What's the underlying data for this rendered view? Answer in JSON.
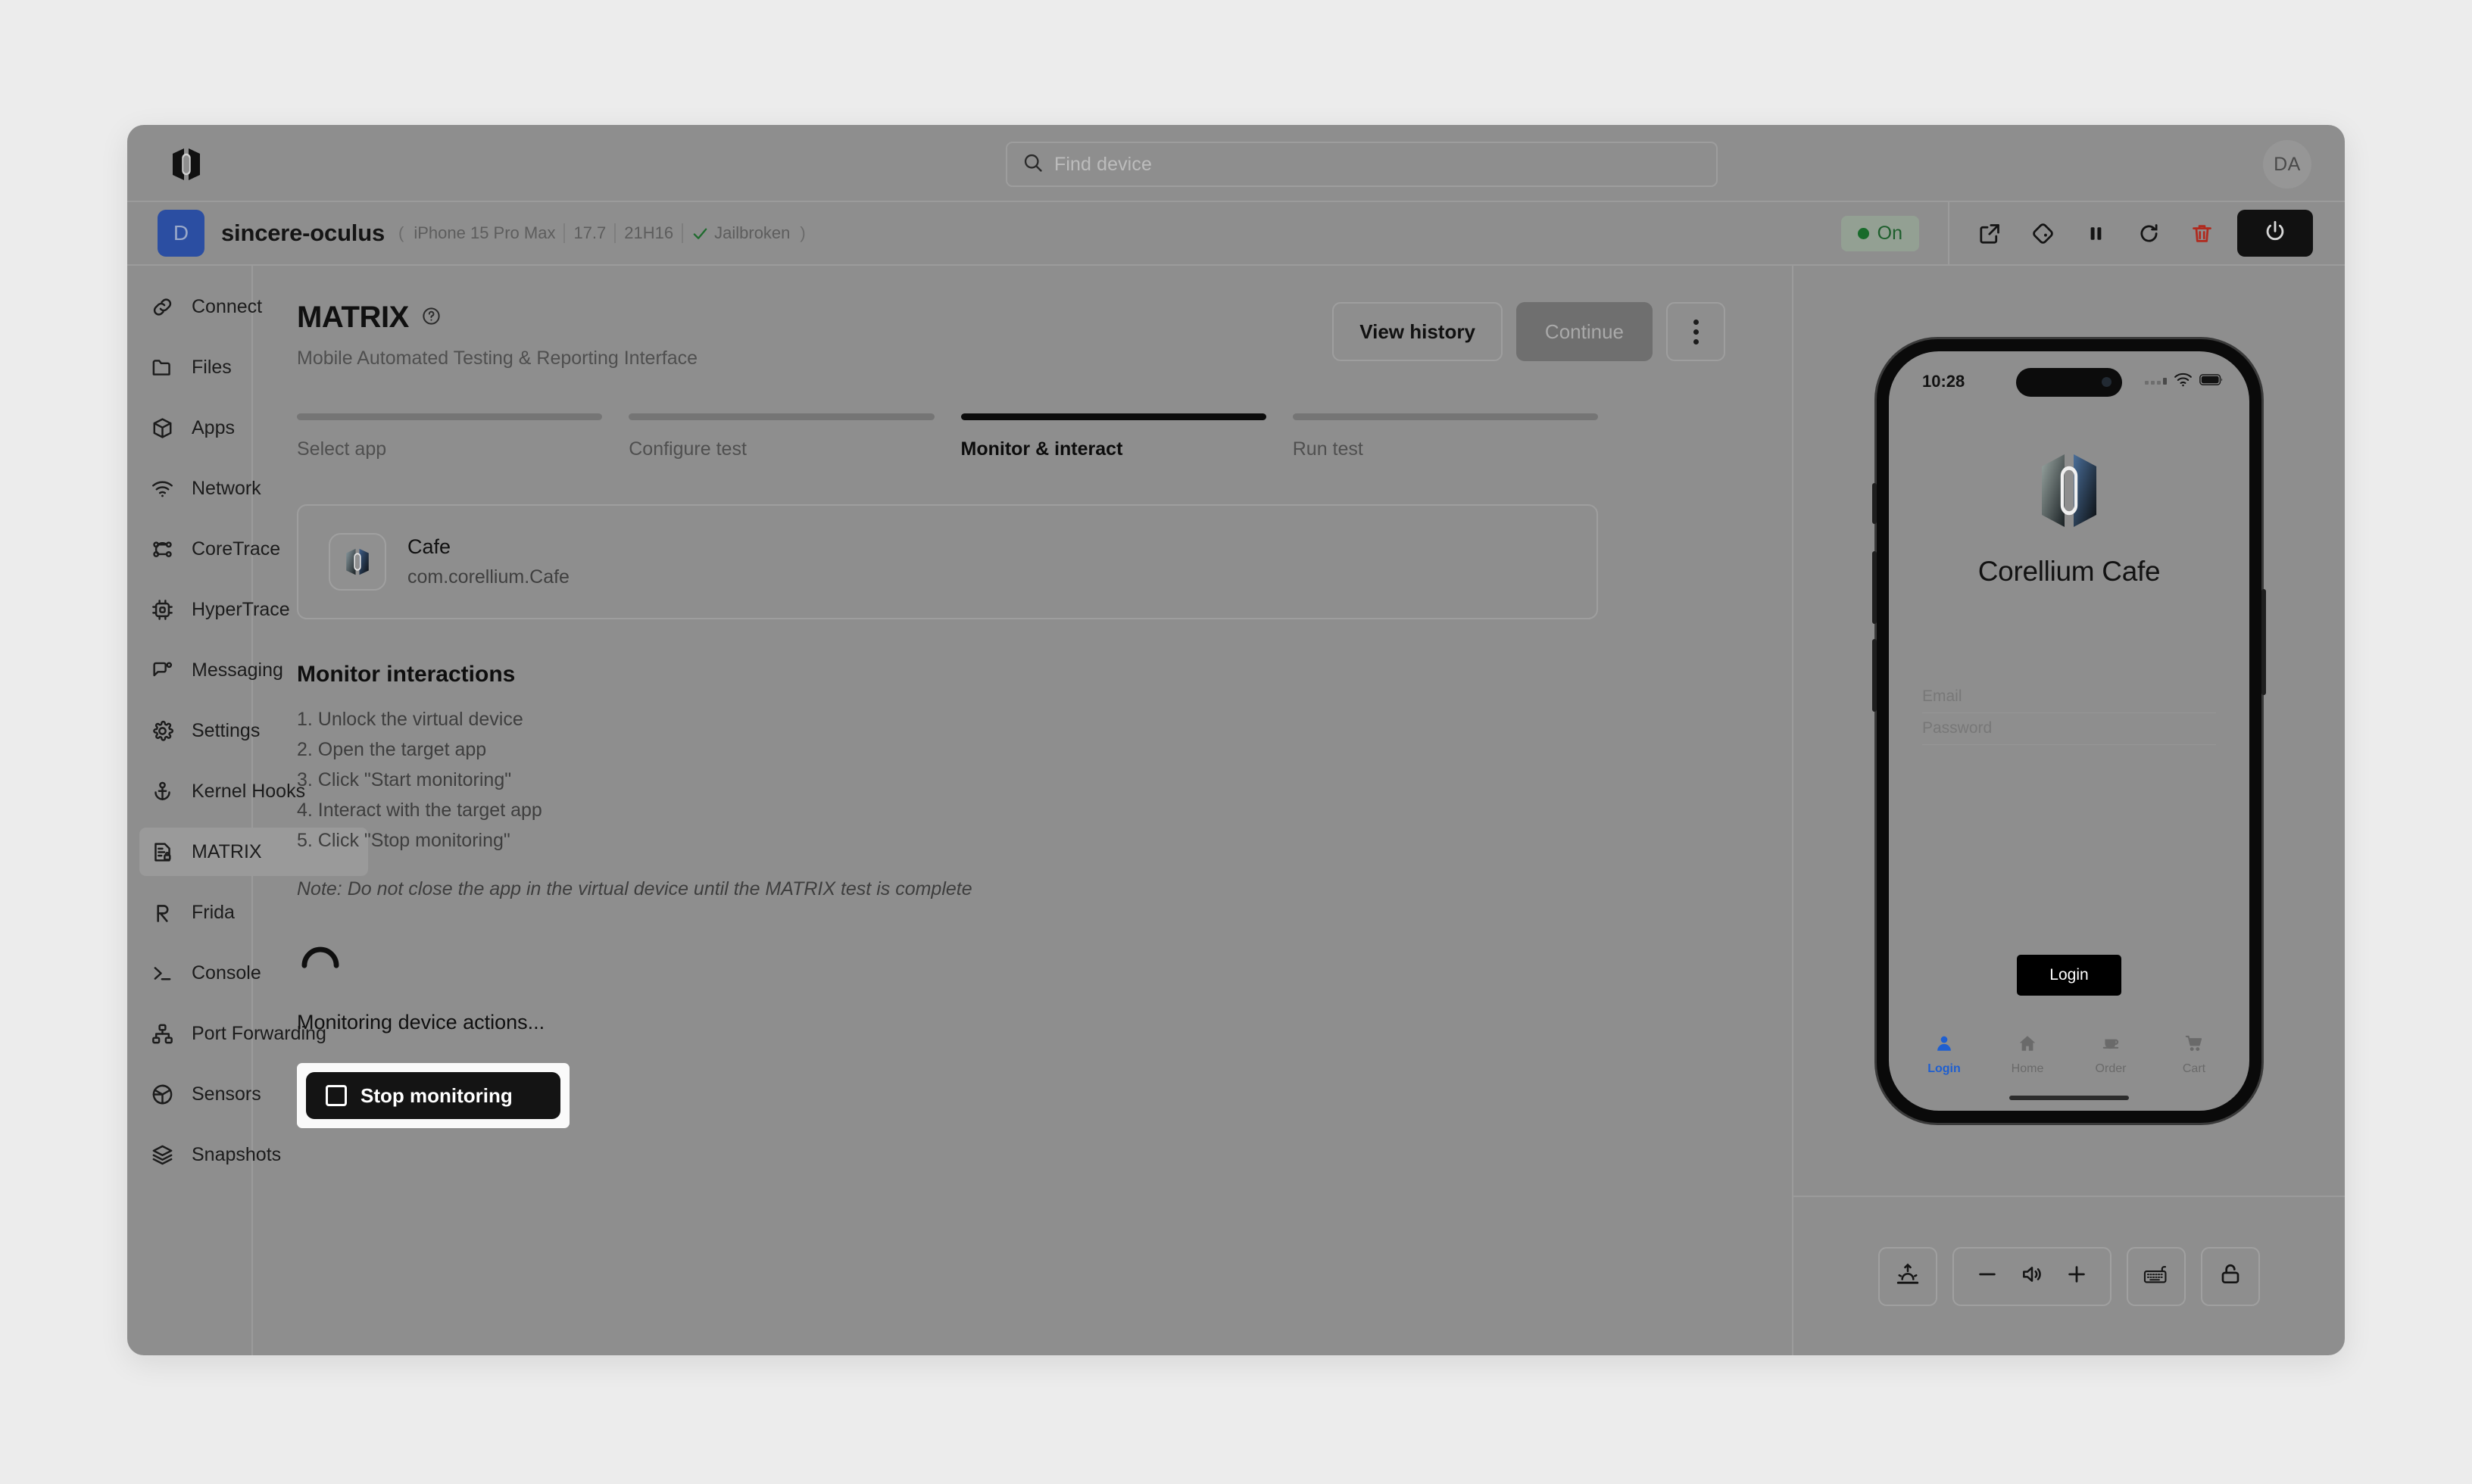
{
  "topbar": {
    "logo_icon": "corellium-logo",
    "search": {
      "icon": "search-icon",
      "placeholder": "Find device",
      "value": ""
    },
    "avatar_initials": "DA"
  },
  "device_header": {
    "badge_letter": "D",
    "name": "sincere-oculus",
    "paren_open": "(",
    "paren_close": ")",
    "model": "iPhone 15 Pro Max",
    "os_version": "17.7",
    "build": "21H16",
    "jailbroken_label": "Jailbroken",
    "jailbroken_icon": "check-icon",
    "status_label": "On",
    "status_color": "#186b2b",
    "actions": [
      {
        "name": "open-external-icon"
      },
      {
        "name": "rotate-device-icon"
      },
      {
        "name": "pause-icon"
      },
      {
        "name": "restart-icon"
      },
      {
        "name": "delete-icon"
      }
    ],
    "power_icon": "power-icon"
  },
  "sidebar": {
    "items": [
      {
        "label": "Connect",
        "icon": "link-icon",
        "active": false
      },
      {
        "label": "Files",
        "icon": "folder-icon",
        "active": false
      },
      {
        "label": "Apps",
        "icon": "cube-icon",
        "active": false
      },
      {
        "label": "Network",
        "icon": "wifi-icon",
        "active": false
      },
      {
        "label": "CoreTrace",
        "icon": "flow-icon",
        "active": false
      },
      {
        "label": "HyperTrace",
        "icon": "chip-icon",
        "active": false
      },
      {
        "label": "Messaging",
        "icon": "chat-icon",
        "active": false
      },
      {
        "label": "Settings",
        "icon": "gear-icon",
        "active": false
      },
      {
        "label": "Kernel Hooks",
        "icon": "anchor-icon",
        "active": false
      },
      {
        "label": "MATRIX",
        "icon": "report-lock-icon",
        "active": true
      },
      {
        "label": "Frida",
        "icon": "frida-icon",
        "active": false
      },
      {
        "label": "Console",
        "icon": "terminal-icon",
        "active": false
      },
      {
        "label": "Port Forwarding",
        "icon": "sitemap-icon",
        "active": false
      },
      {
        "label": "Sensors",
        "icon": "aperture-icon",
        "active": false
      },
      {
        "label": "Snapshots",
        "icon": "layers-icon",
        "active": false
      }
    ]
  },
  "main": {
    "title": "MATRIX",
    "title_help_icon": "help-circle-icon",
    "subtitle": "Mobile Automated Testing & Reporting Interface",
    "actions": {
      "view_history": "View history",
      "continue": "Continue",
      "kebab_icon": "more-vertical-icon"
    },
    "steps": [
      {
        "label": "Select app",
        "active": false
      },
      {
        "label": "Configure test",
        "active": false
      },
      {
        "label": "Monitor & interact",
        "active": true
      },
      {
        "label": "Run test",
        "active": false
      }
    ],
    "selected_app": {
      "icon": "cafe-app-icon",
      "name": "Cafe",
      "bundle_id": "com.corellium.Cafe"
    },
    "monitor": {
      "heading": "Monitor interactions",
      "steps": [
        "1. Unlock the virtual device",
        "2. Open the target app",
        "3. Click \"Start monitoring\"",
        "4. Interact with the target app",
        "5. Click \"Stop monitoring\""
      ],
      "note": "Note: Do not close the app in the virtual device until the MATRIX test is complete",
      "spinner_icon": "loading-spinner-icon",
      "status_text": "Monitoring device actions...",
      "stop_button": {
        "label": "Stop monitoring",
        "icon": "stop-square-icon"
      }
    }
  },
  "device_preview": {
    "status_bar": {
      "time": "10:28",
      "cellular_icon": "cellular-icon",
      "wifi_icon": "wifi-icon",
      "battery_icon": "battery-icon"
    },
    "app": {
      "logo_icon": "corellium-cafe-logo",
      "title": "Corellium Cafe",
      "fields": [
        {
          "placeholder": "Email"
        },
        {
          "placeholder": "Password"
        }
      ],
      "login_button": "Login",
      "tabs": [
        {
          "label": "Login",
          "icon": "person-icon",
          "active": true
        },
        {
          "label": "Home",
          "icon": "home-icon",
          "active": false
        },
        {
          "label": "Order",
          "icon": "coffee-icon",
          "active": false
        },
        {
          "label": "Cart",
          "icon": "cart-icon",
          "active": false
        }
      ]
    },
    "controls": [
      {
        "name": "screenshot-button",
        "icon": "sunrise-upload-icon"
      },
      {
        "name": "volume-down-button",
        "icon": "minus-icon"
      },
      {
        "name": "volume-icon",
        "icon": "speaker-icon"
      },
      {
        "name": "volume-up-button",
        "icon": "plus-icon"
      },
      {
        "name": "keyboard-button",
        "icon": "keyboard-icon"
      },
      {
        "name": "lock-button",
        "icon": "unlock-icon"
      }
    ]
  }
}
